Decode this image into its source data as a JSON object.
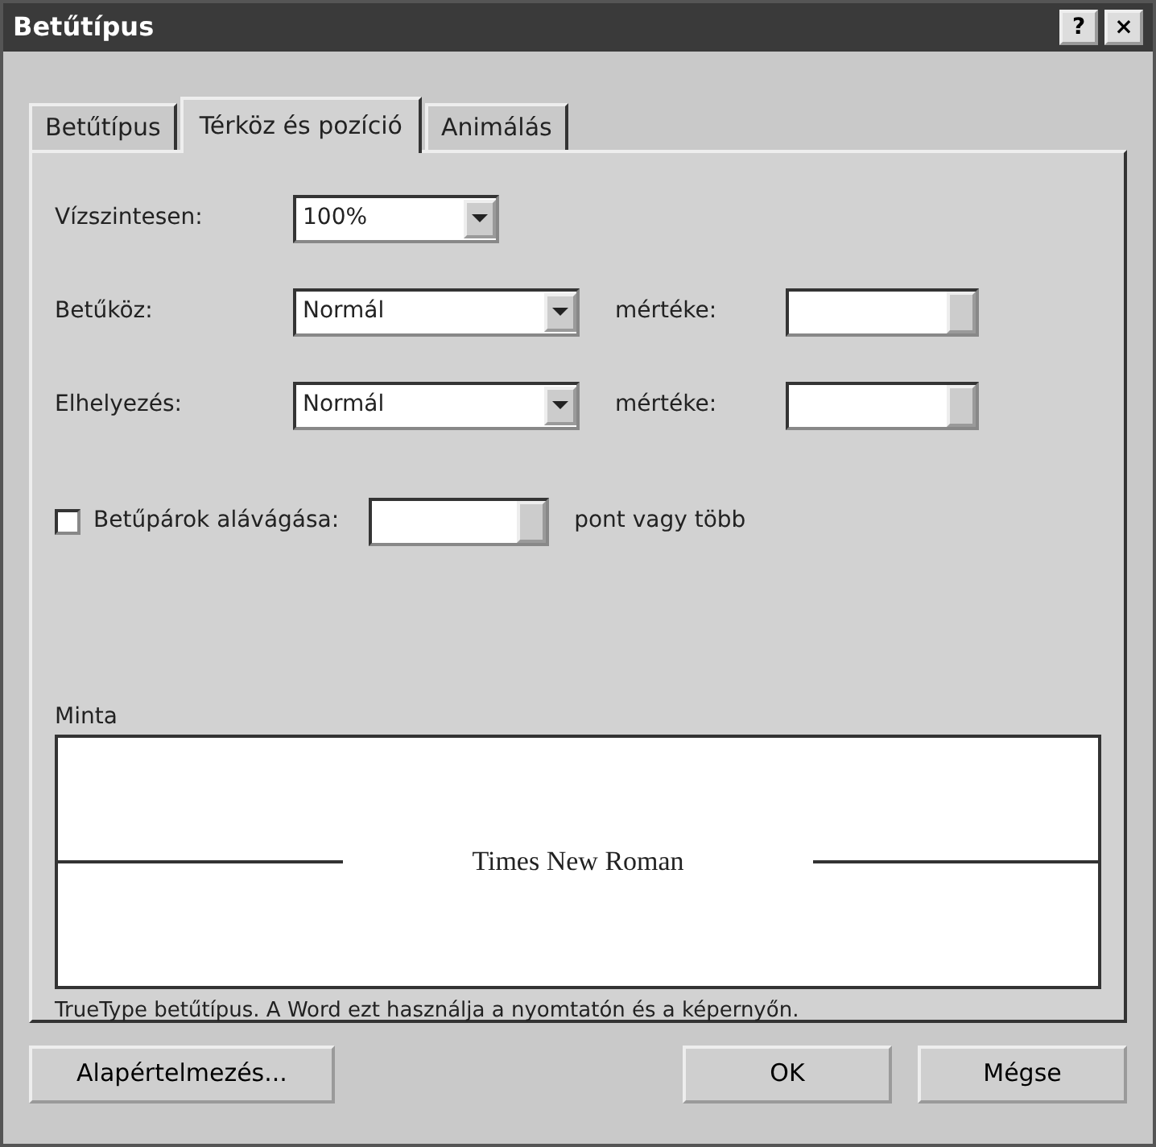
{
  "window": {
    "title": "Betűtípus"
  },
  "title_buttons": [
    "?",
    "×"
  ],
  "tabs": [
    {
      "label": "Betűtípus",
      "selected": false
    },
    {
      "label": "Térköz és pozíció",
      "selected": true
    },
    {
      "label": "Animálás",
      "selected": false
    }
  ],
  "scale": {
    "label": "Vízszintesen:",
    "value": "100%"
  },
  "rows": [
    {
      "label": "Betűköz:",
      "value": "Normál",
      "by_label": "mértéke:"
    },
    {
      "label": "Elhelyezés:",
      "value": "Normál",
      "by_label": "mértéke:"
    }
  ],
  "kerning": {
    "label": "Betűpárok alávágása:",
    "checked": false,
    "suffix": "pont vagy több"
  },
  "preview": {
    "label": "Minta",
    "sample": "Times New Roman"
  },
  "note": "TrueType betűtípus. A Word ezt használja a nyomtatón és a képernyőn.",
  "buttons": [
    {
      "label": "Alapértelmezés...",
      "kind": "left"
    },
    {
      "label": "OK",
      "kind": "right"
    },
    {
      "label": "Mégse",
      "kind": "right"
    }
  ]
}
